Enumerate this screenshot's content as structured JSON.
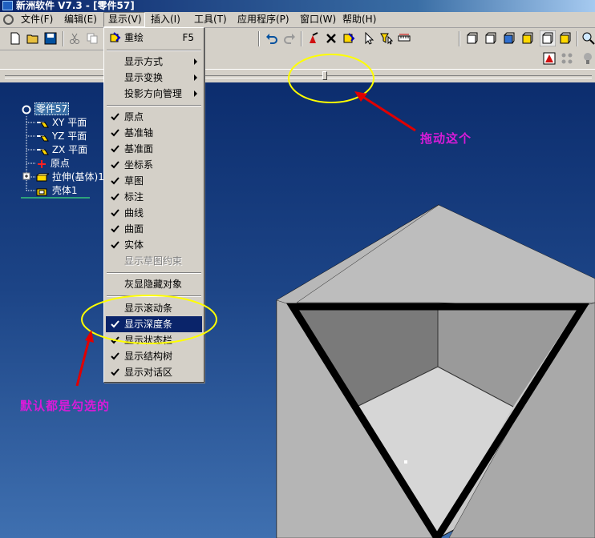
{
  "window": {
    "title": "新洲软件 V7.3 - [零件57]"
  },
  "menubar": {
    "items": [
      {
        "label": "文件(F)"
      },
      {
        "label": "编辑(E)"
      },
      {
        "label": "显示(V)"
      },
      {
        "label": "插入(I)"
      },
      {
        "label": "工具(T)"
      },
      {
        "label": "应用程序(P)"
      },
      {
        "label": "窗口(W)"
      },
      {
        "label": "帮助(H)"
      }
    ]
  },
  "display_menu": {
    "redraw": {
      "label": "重绘",
      "shortcut": "F5"
    },
    "submenus": [
      {
        "label": "显示方式"
      },
      {
        "label": "显示变换"
      },
      {
        "label": "投影方向管理"
      }
    ],
    "toggles": [
      {
        "label": "原点",
        "checked": true
      },
      {
        "label": "基准轴",
        "checked": true
      },
      {
        "label": "基准面",
        "checked": true
      },
      {
        "label": "坐标系",
        "checked": true
      },
      {
        "label": "草图",
        "checked": true
      },
      {
        "label": "标注",
        "checked": true
      },
      {
        "label": "曲线",
        "checked": true
      },
      {
        "label": "曲面",
        "checked": true
      },
      {
        "label": "实体",
        "checked": true
      },
      {
        "label": "显示草图约束",
        "checked": false,
        "disabled": true
      }
    ],
    "gray_hidden": {
      "label": "灰显隐藏对象"
    },
    "panels": [
      {
        "label": "显示滚动条",
        "checked": false
      },
      {
        "label": "显示深度条",
        "checked": true,
        "highlighted": true
      },
      {
        "label": "显示状态栏",
        "checked": true
      },
      {
        "label": "显示结构树",
        "checked": true
      },
      {
        "label": "显示对话区",
        "checked": true
      }
    ]
  },
  "tree": {
    "root": "零件57",
    "nodes": [
      {
        "label": "XY 平面"
      },
      {
        "label": "YZ 平面"
      },
      {
        "label": "ZX 平面"
      },
      {
        "label": "原点"
      },
      {
        "label": "拉伸(基体)1"
      },
      {
        "label": "壳体1"
      }
    ]
  },
  "annotations": {
    "drag_hint": "拖动这个",
    "default_checked": "默认都是勾选的"
  },
  "colors": {
    "annotation_text": "#d81bd8",
    "ellipse": "#ffff00",
    "arrow": "#e00000",
    "menu_highlight": "#0a246a"
  }
}
